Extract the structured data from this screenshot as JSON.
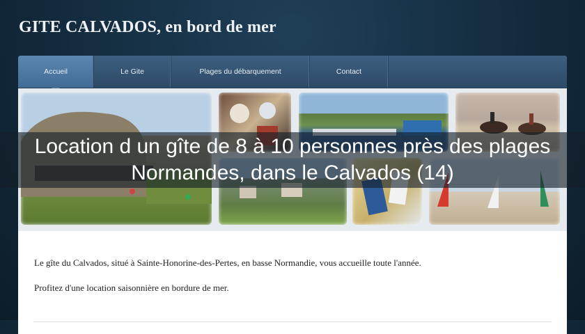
{
  "site": {
    "title": "GITE CALVADOS, en bord de mer"
  },
  "nav": {
    "items": [
      {
        "label": "Accueil"
      },
      {
        "label": "Le Gite"
      },
      {
        "label": "Plages du débarquement"
      },
      {
        "label": "Contact"
      }
    ],
    "active_index": 0
  },
  "banner": {
    "images": [
      "bunker-photo",
      "kitchen-cups-photo",
      "harbour-photo",
      "horse-riders-beach-photo",
      "village-rooftops-photo",
      "beach-chairs-photo",
      "sand-yachts-photo"
    ]
  },
  "overlay": {
    "text": "Location d un gîte de 8 à 10 personnes près des plages Normandes, dans le Calvados (14)"
  },
  "content": {
    "paragraphs": [
      "Le gîte du Calvados, situé à Sainte-Honorine-des-Pertes, en basse Normandie, vous accueille toute l'année.",
      "Profitez d'une location saisonnière en bordure de mer."
    ]
  },
  "colors": {
    "background": "#132b3d",
    "nav": "#2d4a67",
    "nav_active": "#4f79a3",
    "overlay": "#141e28"
  }
}
